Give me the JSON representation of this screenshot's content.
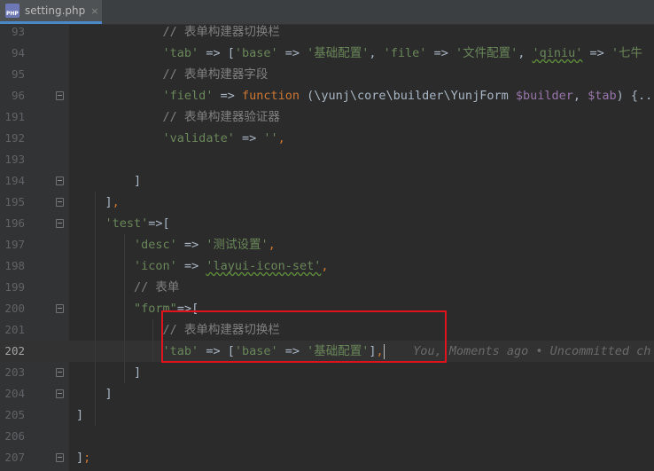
{
  "tab": {
    "icon": "php-file-icon",
    "icon_text": "PHP",
    "filename": "setting.php",
    "close": "×"
  },
  "colors": {
    "accent": "#4a88c7",
    "highlight_box": "#e0121c",
    "string": "#6a8759",
    "comment": "#808080",
    "keyword": "#cc7832",
    "variable": "#9876aa"
  },
  "lines": [
    {
      "n": "93",
      "t": [
        [
          "cmt",
          "            // 表单构建器切换栏"
        ]
      ]
    },
    {
      "n": "94",
      "t": [
        [
          "cn",
          "            "
        ],
        [
          "str",
          "'tab'"
        ],
        [
          "cn",
          " => ["
        ],
        [
          "str",
          "'base'"
        ],
        [
          "cn",
          " => "
        ],
        [
          "str",
          "'基础配置'"
        ],
        [
          "cn",
          ", "
        ],
        [
          "str",
          "'file'"
        ],
        [
          "cn",
          " => "
        ],
        [
          "str",
          "'文件配置'"
        ],
        [
          "cn",
          ", "
        ],
        [
          "str",
          "'qiniu'"
        ],
        [
          "cn",
          " => "
        ],
        [
          "str",
          "'七牛"
        ]
      ]
    },
    {
      "n": "95",
      "t": [
        [
          "cmt",
          "            // 表单构建器字段"
        ]
      ]
    },
    {
      "n": "96",
      "t": [
        [
          "cn",
          "            "
        ],
        [
          "str",
          "'field'"
        ],
        [
          "cn",
          " => "
        ],
        [
          "kw",
          "function"
        ],
        [
          "cn",
          " (\\yunj\\core\\builder\\YunjForm "
        ],
        [
          "var",
          "$builder"
        ],
        [
          "cn",
          ", "
        ],
        [
          "var",
          "$tab"
        ],
        [
          "cn",
          ") {..."
        ]
      ]
    },
    {
      "n": "191",
      "t": [
        [
          "cmt",
          "            // 表单构建器验证器"
        ]
      ]
    },
    {
      "n": "192",
      "t": [
        [
          "cn",
          "            "
        ],
        [
          "str",
          "'validate'"
        ],
        [
          "cn",
          " => "
        ],
        [
          "str",
          "''"
        ],
        [
          "kw",
          ","
        ]
      ]
    },
    {
      "n": "193",
      "t": [
        [
          "cn",
          ""
        ]
      ]
    },
    {
      "n": "194",
      "t": [
        [
          "cn",
          "        ]"
        ]
      ]
    },
    {
      "n": "195",
      "t": [
        [
          "cn",
          "    ]"
        ],
        [
          "kw",
          ","
        ]
      ]
    },
    {
      "n": "196",
      "t": [
        [
          "cn",
          "    "
        ],
        [
          "str",
          "'test'"
        ],
        [
          "cn",
          "=>["
        ]
      ]
    },
    {
      "n": "197",
      "t": [
        [
          "cn",
          "        "
        ],
        [
          "str",
          "'desc'"
        ],
        [
          "cn",
          " => "
        ],
        [
          "str",
          "'测试设置'"
        ],
        [
          "kw",
          ","
        ]
      ]
    },
    {
      "n": "198",
      "t": [
        [
          "cn",
          "        "
        ],
        [
          "str",
          "'icon'"
        ],
        [
          "cn",
          " => "
        ],
        [
          "str",
          "'layui-icon-set'"
        ],
        [
          "kw",
          ","
        ]
      ]
    },
    {
      "n": "199",
      "t": [
        [
          "cmt",
          "        // 表单"
        ]
      ]
    },
    {
      "n": "200",
      "t": [
        [
          "cn",
          "        "
        ],
        [
          "str",
          "\"form\""
        ],
        [
          "cn",
          "=>["
        ]
      ]
    },
    {
      "n": "201",
      "t": [
        [
          "cmt",
          "            // 表单构建器切换栏"
        ]
      ]
    },
    {
      "n": "202",
      "t": [
        [
          "cn",
          "            "
        ],
        [
          "str",
          "'tab'"
        ],
        [
          "cn",
          " => ["
        ],
        [
          "str",
          "'base'"
        ],
        [
          "cn",
          " => "
        ],
        [
          "str",
          "'基础配置'"
        ],
        [
          "cn",
          "]"
        ],
        [
          "kw",
          ","
        ]
      ]
    },
    {
      "n": "203",
      "t": [
        [
          "cn",
          "        ]"
        ]
      ]
    },
    {
      "n": "204",
      "t": [
        [
          "cn",
          "    ]"
        ]
      ]
    },
    {
      "n": "205",
      "t": [
        [
          "cn",
          "]"
        ]
      ]
    },
    {
      "n": "206",
      "t": [
        [
          "cn",
          ""
        ]
      ]
    },
    {
      "n": "207",
      "t": [
        [
          "cn",
          "]"
        ],
        [
          "kw",
          ";"
        ]
      ]
    }
  ],
  "blame_text": "You, Moments ago • Uncommitted ch"
}
